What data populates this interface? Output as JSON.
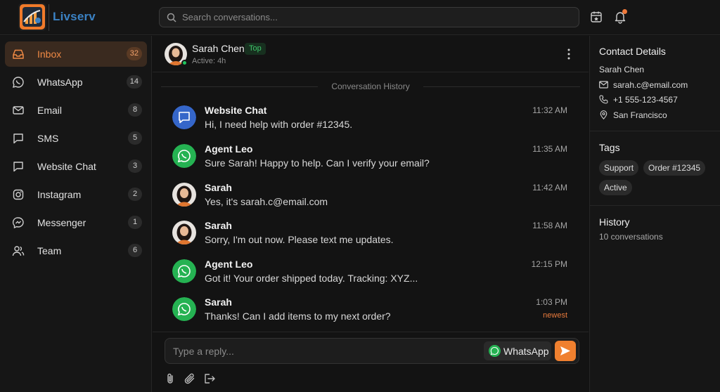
{
  "app": {
    "brand": "Livserv"
  },
  "search": {
    "placeholder": "Search conversations..."
  },
  "topbar": {
    "calendar_icon": "calendar-icon",
    "bell_icon": "bell-icon",
    "notification_color": "#f0793a"
  },
  "sidebar": {
    "items": [
      {
        "label": "Inbox",
        "count": "32",
        "icon": "inbox-icon",
        "active": true
      },
      {
        "label": "WhatsApp",
        "count": "14",
        "icon": "whatsapp-icon"
      },
      {
        "label": "Email",
        "count": "8",
        "icon": "mail-icon"
      },
      {
        "label": "SMS",
        "count": "5",
        "icon": "sms-icon"
      },
      {
        "label": "Website Chat",
        "count": "3",
        "icon": "chat-icon"
      },
      {
        "label": "Instagram",
        "count": "2",
        "icon": "instagram-icon"
      },
      {
        "label": "Messenger",
        "count": "1",
        "icon": "messenger-icon"
      },
      {
        "label": "Team",
        "count": "6",
        "icon": "team-icon"
      }
    ]
  },
  "conversation": {
    "contact_name": "Sarah Chen",
    "badge": "Top",
    "status": "Active: 4h",
    "history_label": "Conversation History",
    "messages": [
      {
        "sender": "Website Chat",
        "text": "Hi, I need help with order #12345.",
        "time": "11:32 AM",
        "channel": "website-chat"
      },
      {
        "sender": "Agent Leo",
        "text": "Sure Sarah! Happy to help. Can I verify your email?",
        "time": "11:35 AM",
        "channel": "whatsapp"
      },
      {
        "sender": "Sarah",
        "text": "Yes, it's sarah.c@email.com",
        "time": "11:42 AM",
        "channel": "contact"
      },
      {
        "sender": "Sarah",
        "text": "Sorry, I'm out now. Please text me updates.",
        "time": "11:58 AM",
        "channel": "contact"
      },
      {
        "sender": "Agent Leo",
        "text": "Got it! Your order shipped today. Tracking: XYZ...",
        "time": "12:15 PM",
        "channel": "whatsapp"
      },
      {
        "sender": "Sarah",
        "text": "Thanks! Can I add items to my next order?",
        "time": "1:03 PM",
        "channel": "whatsapp",
        "tag": "newest"
      }
    ],
    "reply_placeholder": "Type a reply...",
    "reply_channel": "WhatsApp",
    "accent": "#f0802f"
  },
  "contact_details": {
    "title": "Contact Details",
    "name": "Sarah Chen",
    "email": "sarah.c@email.com",
    "phone": "+1 555-123-4567",
    "location": "San Francisco"
  },
  "tags": {
    "title": "Tags",
    "items": [
      "Support",
      "Order #12345",
      "Active"
    ]
  },
  "history": {
    "title": "History",
    "summary": "10 conversations"
  }
}
